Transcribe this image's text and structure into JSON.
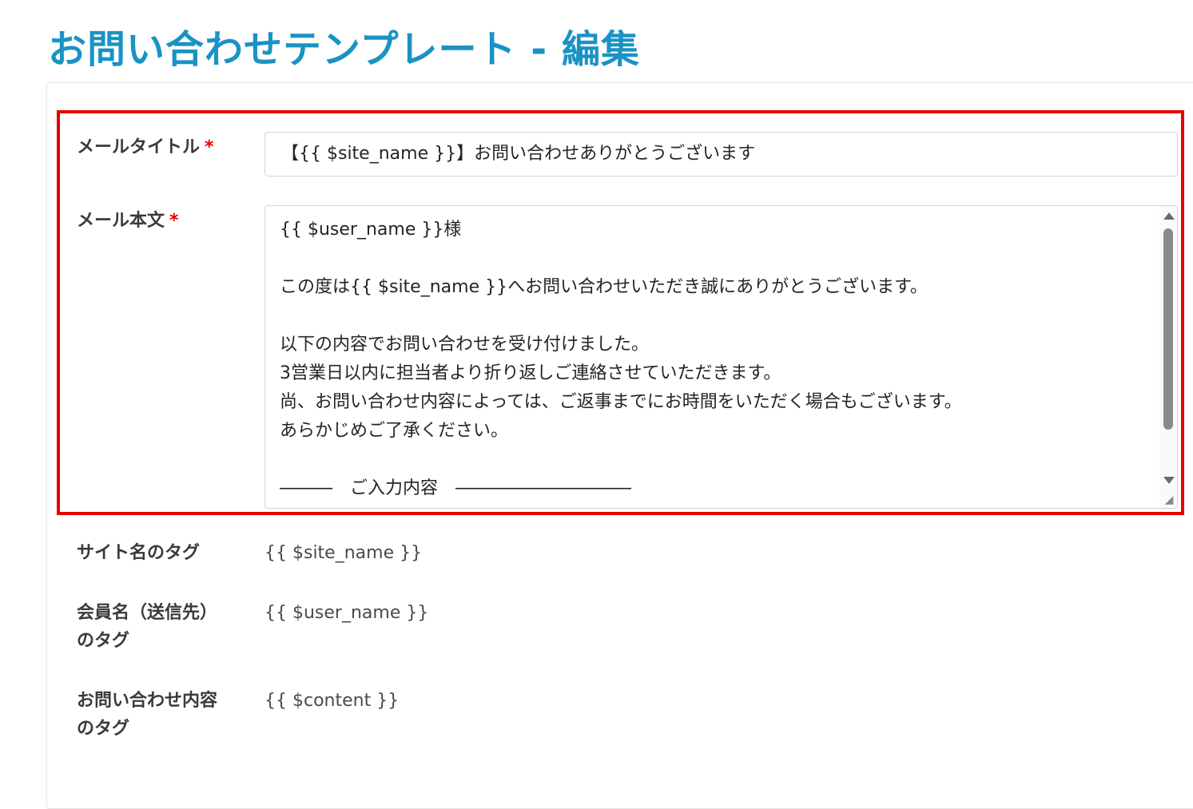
{
  "page": {
    "title": "お問い合わせテンプレート - 編集"
  },
  "form": {
    "mail_title": {
      "label": "メールタイトル",
      "required_mark": "*",
      "value": "【{{ $site_name }}】お問い合わせありがとうございます"
    },
    "mail_body": {
      "label": "メール本文",
      "required_mark": "*",
      "value": "{{ $user_name }}様\n\nこの度は{{ $site_name }}へお問い合わせいただき誠にありがとうございます。\n\n以下の内容でお問い合わせを受け付けました。\n3営業日以内に担当者より折り返しご連絡させていただきます。\n尚、お問い合わせ内容によっては、ご返事までにお時間をいただく場合もございます。\nあらかじめご了承ください。\n\n―――　ご入力内容　――――――――――"
    }
  },
  "tags": [
    {
      "label": "サイト名のタグ",
      "value": "{{ $site_name }}"
    },
    {
      "label": "会員名（送信先）\nのタグ",
      "value": "{{ $user_name }}"
    },
    {
      "label": "お問い合わせ内容\nのタグ",
      "value": "{{ $content }}"
    }
  ],
  "colors": {
    "title": "#1a93c4",
    "highlight_border": "#e60000",
    "required": "#e60000"
  },
  "icons": {
    "scroll_up": "triangle-up",
    "scroll_down": "triangle-down",
    "resize": "resize-grip"
  }
}
